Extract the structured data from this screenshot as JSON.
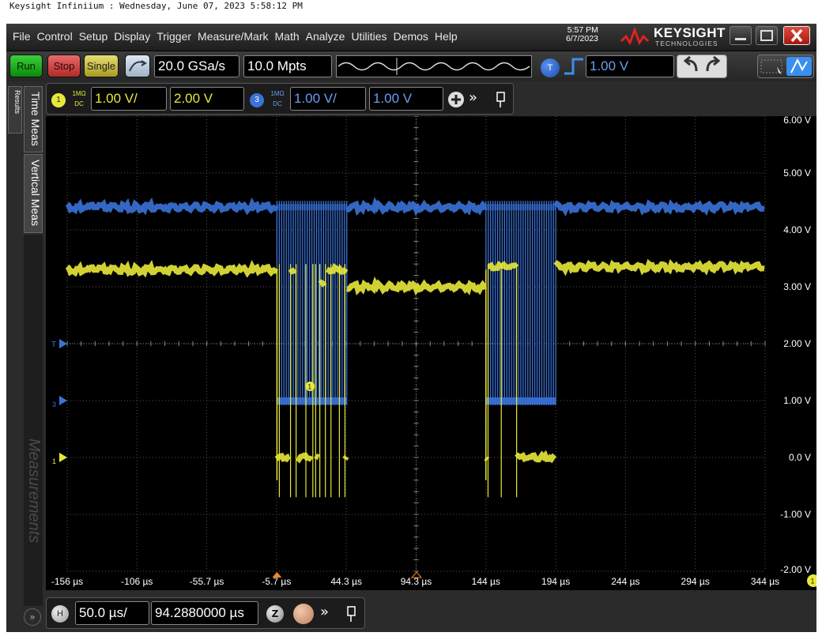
{
  "window_title": "Keysight Infiniium : Wednesday, June 07, 2023 5:58:12 PM",
  "menu": [
    "File",
    "Control",
    "Setup",
    "Display",
    "Trigger",
    "Measure/Mark",
    "Math",
    "Analyze",
    "Utilities",
    "Demos",
    "Help"
  ],
  "clock": {
    "time": "5:57 PM",
    "date": "6/7/2023"
  },
  "brand": {
    "name": "KEYSIGHT",
    "sub": "TECHNOLOGIES"
  },
  "toolbar": {
    "run": "Run",
    "stop": "Stop",
    "single": "Single",
    "sample_rate": "20.0 GSa/s",
    "memory_depth": "10.0 Mpts",
    "trigger_label": "T",
    "trigger_level": "1.00 V"
  },
  "channels": [
    {
      "number": "1",
      "coupling_top": "1MΩ",
      "coupling_bottom": "DC",
      "scale": "1.00 V/",
      "offset": "2.00 V",
      "color": "#e8e83a"
    },
    {
      "number": "3",
      "coupling_top": "1MΩ",
      "coupling_bottom": "DC",
      "scale": "1.00 V/",
      "offset": "1.00 V",
      "color": "#3a72d8"
    }
  ],
  "sidebar": {
    "results": "Results",
    "time_meas": "Time Meas",
    "vertical_meas": "Vertical Meas",
    "measurements": "Measurements"
  },
  "y_axis_labels": [
    "6.00 V",
    "5.00 V",
    "4.00 V",
    "3.00 V",
    "2.00 V",
    "1.00 V",
    "0.0 V",
    "-1.00 V",
    "-2.00 V"
  ],
  "x_axis_labels": [
    "-156 µs",
    "-106 µs",
    "-55.7 µs",
    "-5.7 µs",
    "44.3 µs",
    "94.3 µs",
    "144 µs",
    "194 µs",
    "244 µs",
    "294 µs",
    "344 µs"
  ],
  "markers": {
    "trigger": "T",
    "ch1_marker": "1",
    "ch3_marker": "3",
    "axis_badge": "1"
  },
  "horizontal": {
    "label": "H",
    "scale": "50.0 µs/",
    "position": "94.2880000 µs",
    "zoom": "Z"
  },
  "chart_data": {
    "type": "line",
    "x_unit": "µs",
    "y_unit": "V",
    "xlim": [
      -156,
      344
    ],
    "ylim": [
      -2,
      6
    ],
    "grid": true,
    "series": [
      {
        "name": "1",
        "color": "#e8e83a",
        "segments": [
          {
            "x": [
              -156,
              -5.7
            ],
            "y": 3.3
          },
          {
            "x": -5.7,
            "y": 0.0
          },
          {
            "x": 44.3,
            "y": 3.3
          },
          {
            "x": [
              44.3,
              144
            ],
            "y": 3.0
          },
          {
            "x": [
              144,
              166
            ],
            "y": 3.35
          },
          {
            "x": [
              166,
              194
            ],
            "y": 0.0
          },
          {
            "x": [
              194,
              344
            ],
            "y": 3.35
          }
        ]
      },
      {
        "name": "3",
        "color": "#3a72d8",
        "segments": [
          {
            "x": [
              -156,
              -5.7
            ],
            "y": 4.4
          },
          {
            "x": [
              -5.7,
              44.3
            ],
            "y": [
              1.0,
              4.4
            ]
          },
          {
            "x": [
              44.3,
              144
            ],
            "y": 4.4
          },
          {
            "x": [
              144,
              194
            ],
            "y": [
              1.0,
              4.4
            ]
          },
          {
            "x": [
              194,
              344
            ],
            "y": 4.4
          }
        ]
      }
    ]
  }
}
